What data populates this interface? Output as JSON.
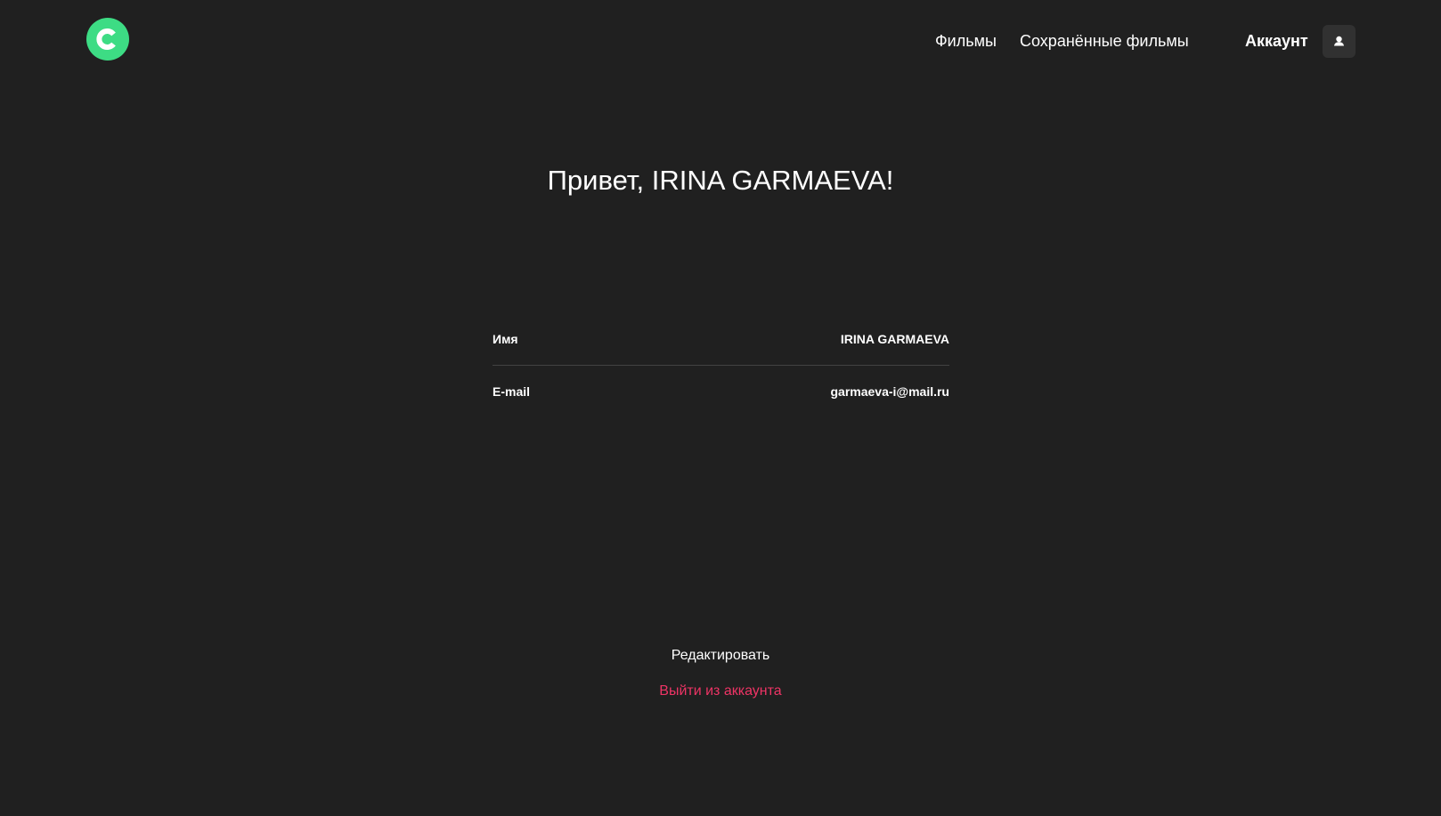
{
  "header": {
    "logo_icon": "logo-c-icon",
    "nav": {
      "films": "Фильмы",
      "saved_films": "Сохранённые фильмы",
      "account": "Аккаунт"
    },
    "account_icon": "user-icon"
  },
  "profile": {
    "greeting": "Привет, IRINA GARMAEVA!",
    "name_label": "Имя",
    "name_value": "IRINA GARMAEVA",
    "email_label": "E-mail",
    "email_value": "garmaeva-i@mail.ru"
  },
  "actions": {
    "edit": "Редактировать",
    "logout": "Выйти из аккаунта"
  },
  "colors": {
    "background": "#202020",
    "accent_green": "#3ddc84",
    "logout_red": "#ee3465",
    "divider": "#424242"
  }
}
